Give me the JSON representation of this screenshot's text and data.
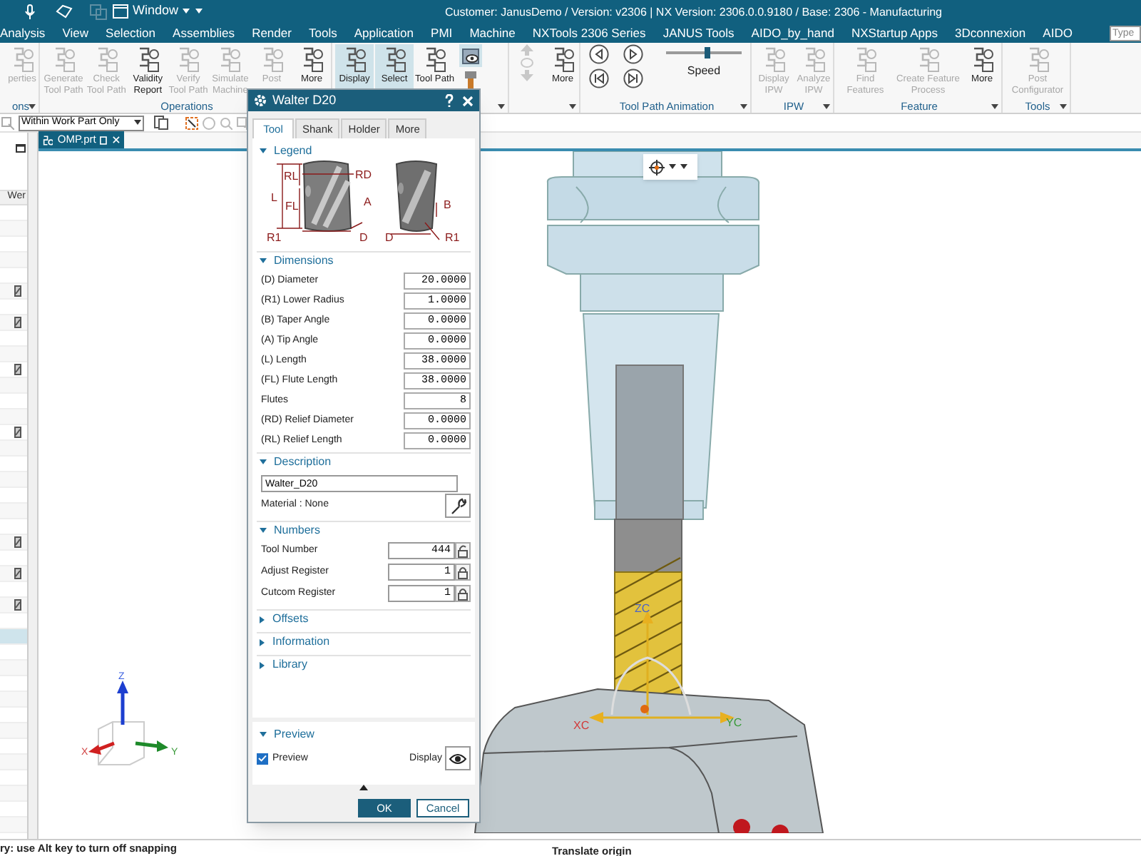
{
  "title_bar": {
    "window_menu": "Window",
    "title": "Customer: JanusDemo / Version: v2306 | NX Version: 2306.0.0.9180 / Base: 2306 - Manufacturing"
  },
  "menu_bar": {
    "items": [
      "Analysis",
      "View",
      "Selection",
      "Assemblies",
      "Render",
      "Tools",
      "Application",
      "PMI",
      "Machine",
      "NXTools 2306 Series",
      "JANUS Tools",
      "AIDO_by_hand",
      "NXStartup Apps",
      "3Dconnexion",
      "AIDO"
    ],
    "search": {
      "placeholder": "Type"
    }
  },
  "ribbon": {
    "groups": [
      {
        "label": "ons",
        "buttons": [
          {
            "label": "perties",
            "disabled": true
          }
        ]
      },
      {
        "label": "Operations",
        "buttons": [
          {
            "label": "Generate Tool Path",
            "disabled": true
          },
          {
            "label": "Check Tool Path",
            "disabled": true
          },
          {
            "label": "Validity Report",
            "disabled": false
          },
          {
            "label": "Verify Tool Path",
            "disabled": true
          },
          {
            "label": "Simulate Machine",
            "disabled": true
          },
          {
            "label": "Post",
            "disabled": true
          },
          {
            "label": "More",
            "disabled": false
          }
        ]
      },
      {
        "buttons": [
          {
            "label": "Display",
            "disabled": false,
            "active": true
          },
          {
            "label": "Select",
            "disabled": false,
            "active": true
          },
          {
            "label": "Tool Path",
            "disabled": false,
            "active": false
          }
        ],
        "icon_buttons": [
          {
            "active": true
          },
          {
            "active": false
          }
        ]
      },
      {
        "buttons": [
          {
            "label": "More",
            "disabled": false
          }
        ]
      },
      {
        "label": "Tool Path Animation",
        "slider": {
          "label": "Speed",
          "level": 0.55
        }
      },
      {
        "label": "IPW",
        "buttons": [
          {
            "label": "Display IPW",
            "disabled": true
          },
          {
            "label": "Analyze IPW",
            "disabled": true
          }
        ]
      },
      {
        "label": "Feature",
        "buttons": [
          {
            "label": "Find Features",
            "disabled": true
          },
          {
            "label": "Create Feature Process",
            "disabled": true
          },
          {
            "label": "More",
            "disabled": false
          }
        ]
      },
      {
        "label": "Tools",
        "buttons": [
          {
            "label": "Post Configurator",
            "disabled": true
          }
        ]
      }
    ]
  },
  "selection_bar": {
    "filter": "Within Work Part Only"
  },
  "navigator": {
    "column": "Wer",
    "rows": [
      {
        "kind": "blank",
        "selected": false
      },
      {
        "kind": "blank",
        "selected": false
      },
      {
        "kind": "blank",
        "selected": false
      },
      {
        "kind": "blank",
        "selected": false
      },
      {
        "kind": "blank",
        "selected": false
      },
      {
        "kind": "tool",
        "selected": false
      },
      {
        "kind": "blank",
        "selected": false
      },
      {
        "kind": "tool",
        "selected": false
      },
      {
        "kind": "blank",
        "selected": false
      },
      {
        "kind": "blank",
        "selected": false
      },
      {
        "kind": "tool",
        "selected": false
      },
      {
        "kind": "blank",
        "selected": false
      },
      {
        "kind": "blank",
        "selected": false
      },
      {
        "kind": "blank",
        "selected": false
      },
      {
        "kind": "tool",
        "selected": false
      },
      {
        "kind": "blank",
        "selected": false
      },
      {
        "kind": "blank",
        "selected": false
      },
      {
        "kind": "blank",
        "selected": false
      },
      {
        "kind": "blank",
        "selected": false
      },
      {
        "kind": "blank",
        "selected": false
      },
      {
        "kind": "blank",
        "selected": false
      },
      {
        "kind": "tool",
        "selected": false
      },
      {
        "kind": "blank",
        "selected": false
      },
      {
        "kind": "tool",
        "selected": false
      },
      {
        "kind": "blank",
        "selected": false
      },
      {
        "kind": "tool",
        "selected": false
      },
      {
        "kind": "blank",
        "selected": false
      },
      {
        "kind": "blank",
        "selected": true
      },
      {
        "kind": "blank",
        "selected": false
      },
      {
        "kind": "blank",
        "selected": false
      },
      {
        "kind": "blank",
        "selected": false
      },
      {
        "kind": "blank",
        "selected": false
      },
      {
        "kind": "blank",
        "selected": false
      },
      {
        "kind": "blank",
        "selected": false
      },
      {
        "kind": "blank",
        "selected": false
      },
      {
        "kind": "blank",
        "selected": false
      },
      {
        "kind": "blank",
        "selected": false
      },
      {
        "kind": "blank",
        "selected": false
      },
      {
        "kind": "blank",
        "selected": false
      },
      {
        "kind": "blank",
        "selected": false
      }
    ]
  },
  "viewport": {
    "tab": "OMP.prt",
    "triad_labels": [
      "Z",
      "X",
      "Y"
    ],
    "gizmo_labels": [
      "ZC",
      "XC",
      "YC"
    ]
  },
  "dialog": {
    "title": "Walter D20",
    "tabs": [
      {
        "label": "Tool",
        "selected": true
      },
      {
        "label": "Shank",
        "selected": false
      },
      {
        "label": "Holder",
        "selected": false
      },
      {
        "label": "More",
        "selected": false
      }
    ],
    "legend": {
      "title": "Legend",
      "expanded": true,
      "labels": [
        "RL",
        "RD",
        "L",
        "FL",
        "A",
        "R1",
        "D",
        "B",
        "D",
        "R1"
      ]
    },
    "dimensions": {
      "title": "Dimensions",
      "expanded": true,
      "rows": [
        {
          "label": "(D) Diameter",
          "value": "20.0000"
        },
        {
          "label": "(R1) Lower Radius",
          "value": "1.0000"
        },
        {
          "label": "(B) Taper Angle",
          "value": "0.0000"
        },
        {
          "label": "(A) Tip Angle",
          "value": "0.0000"
        },
        {
          "label": "(L) Length",
          "value": "38.0000"
        },
        {
          "label": "(FL) Flute Length",
          "value": "38.0000"
        },
        {
          "label": "Flutes",
          "value": "8"
        },
        {
          "label": "(RD) Relief Diameter",
          "value": "0.0000"
        },
        {
          "label": "(RL) Relief Length",
          "value": "0.0000"
        }
      ]
    },
    "description": {
      "title": "Description",
      "expanded": true,
      "value": "Walter_D20",
      "material": "Material : None"
    },
    "numbers": {
      "title": "Numbers",
      "expanded": true,
      "rows": [
        {
          "label": "Tool Number",
          "value": "444",
          "locked": false
        },
        {
          "label": "Adjust Register",
          "value": "1",
          "locked": true
        },
        {
          "label": "Cutcom Register",
          "value": "1",
          "locked": true
        }
      ]
    },
    "collapsed": [
      {
        "title": "Offsets",
        "expanded": false
      },
      {
        "title": "Information",
        "expanded": false
      },
      {
        "title": "Library",
        "expanded": false
      }
    ],
    "preview": {
      "title": "Preview",
      "expanded": true,
      "checkbox": {
        "label": "Preview",
        "checked": true
      },
      "display_label": "Display"
    },
    "buttons": [
      "OK",
      "Cancel"
    ]
  },
  "status_bar": {
    "left": "ry: use Alt key to turn off snapping",
    "center": "Translate origin"
  }
}
